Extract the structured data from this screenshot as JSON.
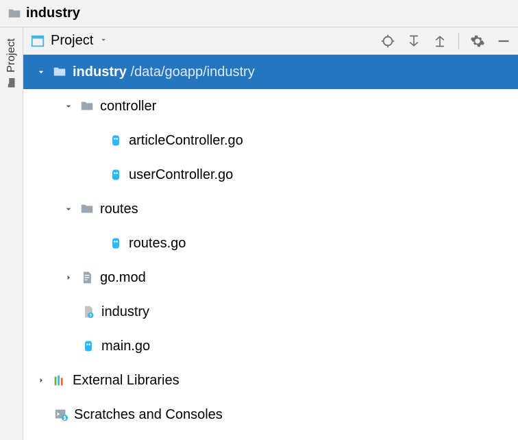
{
  "breadcrumb": {
    "project_name": "industry"
  },
  "sidebar": {
    "project_tab_label": "Project"
  },
  "panel": {
    "title": "Project"
  },
  "tree": {
    "root": {
      "name": "industry",
      "path": "/data/goapp/industry"
    },
    "controller": {
      "name": "controller",
      "files": {
        "article": "articleController.go",
        "user": "userController.go"
      }
    },
    "routes": {
      "name": "routes",
      "files": {
        "routes": "routes.go"
      }
    },
    "gomod": "go.mod",
    "industry_file": "industry",
    "maingo": "main.go",
    "external_libs": "External Libraries",
    "scratches": "Scratches and Consoles"
  }
}
